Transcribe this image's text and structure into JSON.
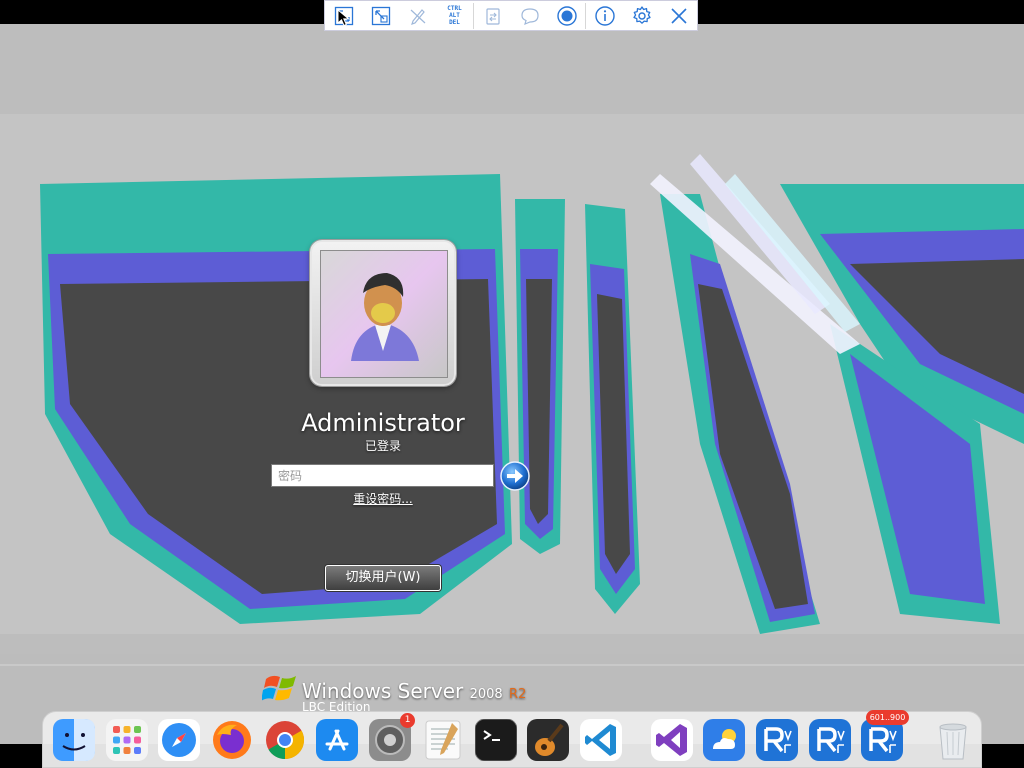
{
  "toolbar": {
    "buttons": [
      {
        "icon": "fullscreen-icon"
      },
      {
        "icon": "scale-icon"
      },
      {
        "icon": "pen-disabled-icon"
      },
      {
        "icon": "ctrl-alt-del-icon",
        "label_lines": [
          "CTRL",
          "ALT",
          "DEL"
        ]
      },
      {
        "icon": "clipboard-icon"
      },
      {
        "icon": "chat-icon"
      },
      {
        "icon": "record-icon"
      },
      {
        "icon": "info-icon"
      },
      {
        "icon": "gear-icon"
      },
      {
        "icon": "close-icon"
      }
    ]
  },
  "login": {
    "username": "Administrator",
    "status": "已登录",
    "password_placeholder": "密码",
    "reset_link": "重设密码...",
    "switch_user": "切换用户(W)"
  },
  "branding": {
    "product": "Windows Server",
    "version": "2008",
    "release": "R2",
    "edition": "LBC Edition"
  },
  "dock": {
    "apps": [
      "Finder",
      "Launchpad",
      "Safari",
      "Firefox",
      "Chrome",
      "App Store",
      "System Preferences",
      "TextEdit",
      "Terminal",
      "GarageBand",
      "Visual Studio Code",
      "Visual Studio",
      "Weather",
      "VNC Viewer",
      "VNC Viewer",
      "VNC Viewer",
      "Trash"
    ],
    "badges": {
      "system_preferences": "1",
      "vnc_3": "601..900"
    }
  },
  "colors": {
    "accent": "#2a76d6",
    "wallpaper_teal": "#2fb7a6",
    "wallpaper_blue": "#5b5bd0",
    "wallpaper_gray": "#4a4a4a",
    "brand_orange": "#e26a1b"
  }
}
